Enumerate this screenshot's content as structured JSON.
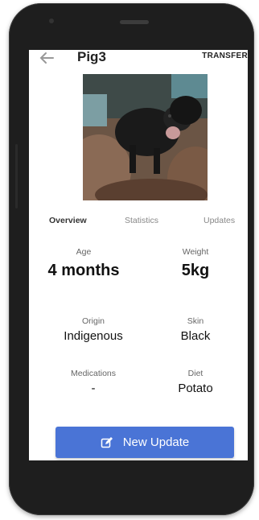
{
  "app_bar": {
    "title": "Pig3",
    "transfer_label": "TRANSFER",
    "back_icon": "arrow-left-icon"
  },
  "tabs": [
    {
      "label": "Overview",
      "active": true
    },
    {
      "label": "Statistics",
      "active": false
    },
    {
      "label": "Updates",
      "active": false
    }
  ],
  "stats": {
    "age": {
      "label": "Age",
      "value": "4 months"
    },
    "weight": {
      "label": "Weight",
      "value": "5kg"
    },
    "origin": {
      "label": "Origin",
      "value": "Indigenous"
    },
    "skin": {
      "label": "Skin",
      "value": "Black"
    },
    "medications": {
      "label": "Medications",
      "value": "-"
    },
    "diet": {
      "label": "Diet",
      "value": "Potato"
    }
  },
  "actions": {
    "new_update_label": "New Update",
    "new_update_icon": "edit-icon"
  },
  "colors": {
    "primary": "#4a74d6",
    "phone_body": "#1e1e1e"
  }
}
